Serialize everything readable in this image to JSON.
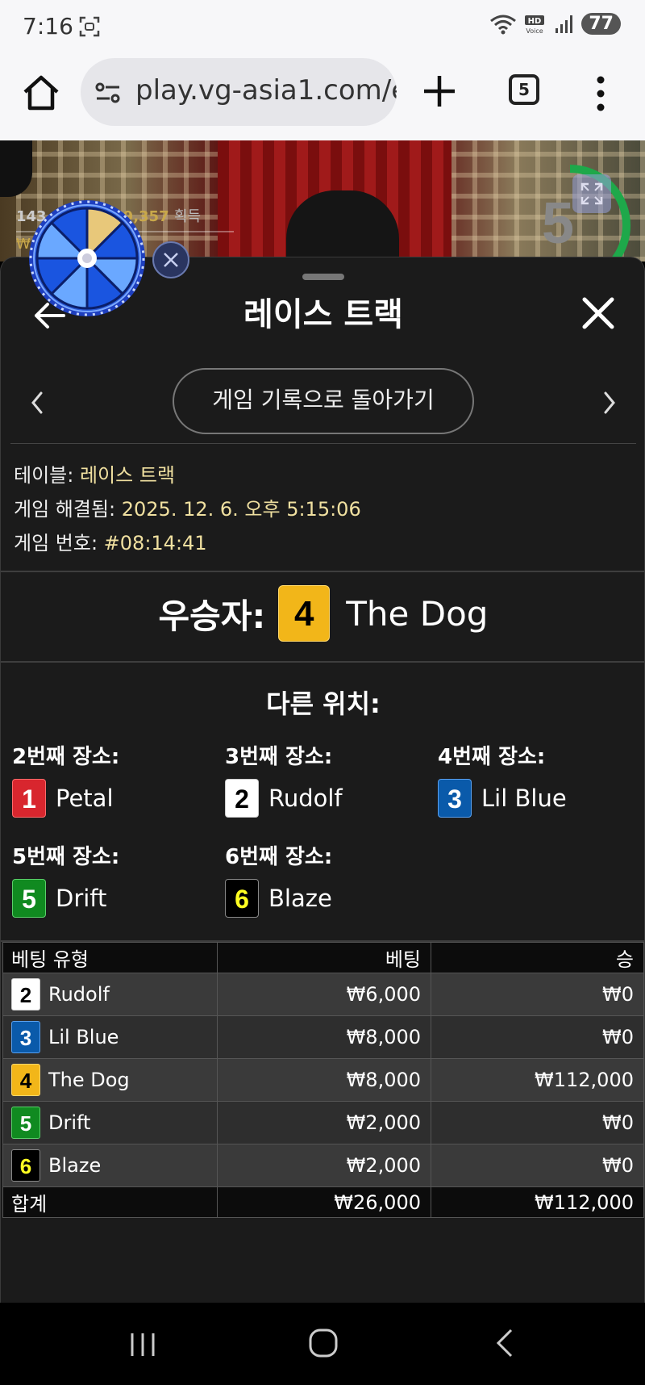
{
  "status": {
    "time": "7:16",
    "battery": "77",
    "network": "HD Voice"
  },
  "browser": {
    "url": "play.vg-asia1.com/e",
    "tab_count": "5"
  },
  "video": {
    "stats_left": "143",
    "stats_mid": "09,357",
    "stats_suffix": "획득",
    "stats_line2": "₩",
    "countdown": "5"
  },
  "sheet": {
    "title": "레이스 트랙",
    "history_button": "게임 기록으로 돌아가기",
    "info": [
      {
        "label": "테이블: ",
        "value": "레이스 트랙"
      },
      {
        "label": "게임 해결됨: ",
        "value": "2025. 12. 6. 오후 5:15:06"
      },
      {
        "label": "게임 번호: ",
        "value": "#08:14:41"
      }
    ],
    "winner": {
      "label": "우승자:",
      "number": "4",
      "name": "The Dog"
    },
    "other_title": "다른 위치:",
    "places": [
      {
        "label": "2번째 장소:",
        "number": "1",
        "name": "Petal"
      },
      {
        "label": "3번째 장소:",
        "number": "2",
        "name": "Rudolf"
      },
      {
        "label": "4번째 장소:",
        "number": "3",
        "name": "Lil Blue"
      },
      {
        "label": "5번째 장소:",
        "number": "5",
        "name": "Drift"
      },
      {
        "label": "6번째 장소:",
        "number": "6",
        "name": "Blaze"
      }
    ]
  },
  "table": {
    "headers": [
      "베팅 유형",
      "베팅",
      "승"
    ],
    "rows": [
      {
        "number": "2",
        "name": "Rudolf",
        "bet": "₩6,000",
        "win": "₩0"
      },
      {
        "number": "3",
        "name": "Lil Blue",
        "bet": "₩8,000",
        "win": "₩0"
      },
      {
        "number": "4",
        "name": "The Dog",
        "bet": "₩8,000",
        "win": "₩112,000"
      },
      {
        "number": "5",
        "name": "Drift",
        "bet": "₩2,000",
        "win": "₩0"
      },
      {
        "number": "6",
        "name": "Blaze",
        "bet": "₩2,000",
        "win": "₩0"
      }
    ],
    "total": {
      "label": "합계",
      "bet": "₩26,000",
      "win": "₩112,000"
    }
  },
  "colors": {
    "runner_1": "#d8262e",
    "runner_2": "#ffffff",
    "runner_3": "#0a5aaa",
    "runner_4": "#f2b619",
    "runner_5": "#108a20",
    "runner_6": "#000000",
    "sheet_bg": "#1b1b1b",
    "info_value": "#f0e0a0"
  }
}
